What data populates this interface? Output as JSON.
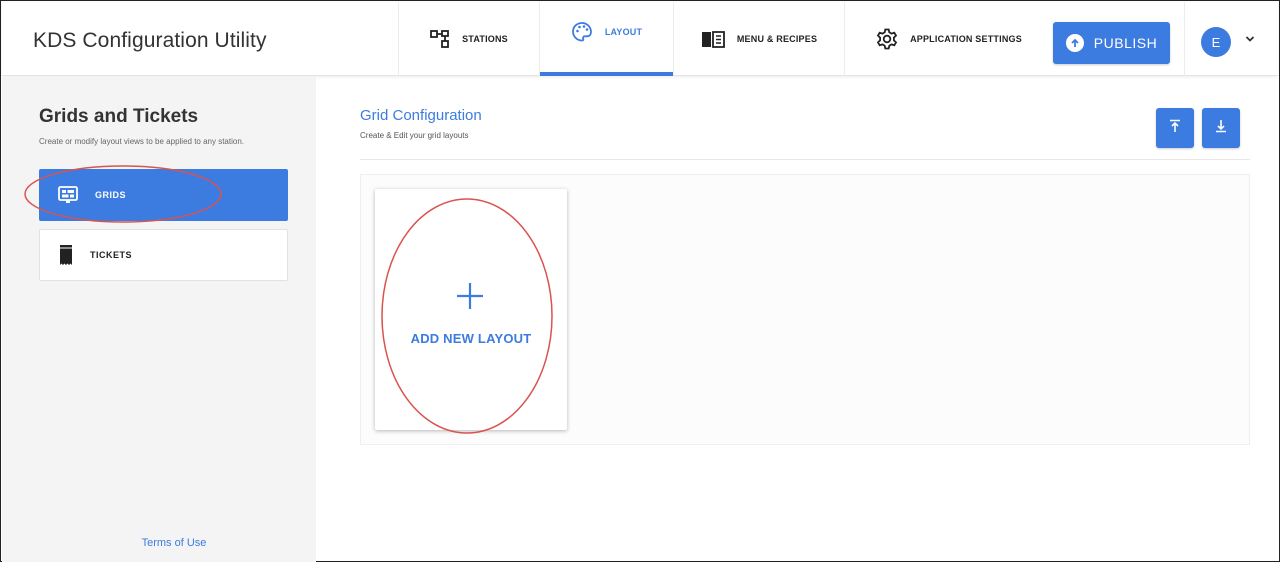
{
  "header": {
    "app_title": "KDS Configuration Utility",
    "nav": [
      {
        "label": "STATIONS",
        "icon": "stations-icon"
      },
      {
        "label": "LAYOUT",
        "icon": "palette-icon"
      },
      {
        "label": "MENU & RECIPES",
        "icon": "book-icon"
      },
      {
        "label": "APPLICATION SETTINGS",
        "icon": "gear-icon"
      }
    ],
    "active_nav": "LAYOUT",
    "publish_label": "PUBLISH",
    "avatar_initial": "E"
  },
  "sidebar": {
    "title": "Grids and Tickets",
    "subtitle": "Create or modify layout views to be applied to any station.",
    "items": [
      {
        "label": "GRIDS",
        "icon": "grid-icon",
        "selected": true
      },
      {
        "label": "TICKETS",
        "icon": "ticket-icon",
        "selected": false
      }
    ],
    "terms": "Terms of Use"
  },
  "main": {
    "title": "Grid Configuration",
    "subtitle": "Create & Edit your grid layouts",
    "actions": [
      {
        "icon": "upload-icon"
      },
      {
        "icon": "download-icon"
      }
    ],
    "add_card_label": "ADD NEW LAYOUT"
  },
  "colors": {
    "accent": "#3c7be0",
    "sidebar_bg": "#f4f4f4",
    "annotation": "#d9534f"
  }
}
